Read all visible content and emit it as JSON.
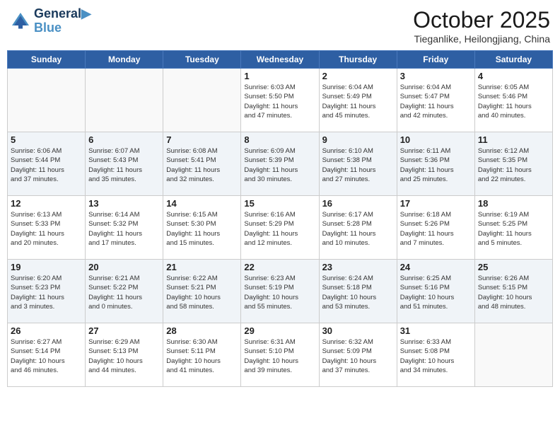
{
  "header": {
    "logo_line1": "General",
    "logo_line2": "Blue",
    "month": "October 2025",
    "location": "Tieganlike, Heilongjiang, China"
  },
  "weekdays": [
    "Sunday",
    "Monday",
    "Tuesday",
    "Wednesday",
    "Thursday",
    "Friday",
    "Saturday"
  ],
  "weeks": [
    [
      {
        "day": "",
        "info": ""
      },
      {
        "day": "",
        "info": ""
      },
      {
        "day": "",
        "info": ""
      },
      {
        "day": "1",
        "info": "Sunrise: 6:03 AM\nSunset: 5:50 PM\nDaylight: 11 hours\nand 47 minutes."
      },
      {
        "day": "2",
        "info": "Sunrise: 6:04 AM\nSunset: 5:49 PM\nDaylight: 11 hours\nand 45 minutes."
      },
      {
        "day": "3",
        "info": "Sunrise: 6:04 AM\nSunset: 5:47 PM\nDaylight: 11 hours\nand 42 minutes."
      },
      {
        "day": "4",
        "info": "Sunrise: 6:05 AM\nSunset: 5:46 PM\nDaylight: 11 hours\nand 40 minutes."
      }
    ],
    [
      {
        "day": "5",
        "info": "Sunrise: 6:06 AM\nSunset: 5:44 PM\nDaylight: 11 hours\nand 37 minutes."
      },
      {
        "day": "6",
        "info": "Sunrise: 6:07 AM\nSunset: 5:43 PM\nDaylight: 11 hours\nand 35 minutes."
      },
      {
        "day": "7",
        "info": "Sunrise: 6:08 AM\nSunset: 5:41 PM\nDaylight: 11 hours\nand 32 minutes."
      },
      {
        "day": "8",
        "info": "Sunrise: 6:09 AM\nSunset: 5:39 PM\nDaylight: 11 hours\nand 30 minutes."
      },
      {
        "day": "9",
        "info": "Sunrise: 6:10 AM\nSunset: 5:38 PM\nDaylight: 11 hours\nand 27 minutes."
      },
      {
        "day": "10",
        "info": "Sunrise: 6:11 AM\nSunset: 5:36 PM\nDaylight: 11 hours\nand 25 minutes."
      },
      {
        "day": "11",
        "info": "Sunrise: 6:12 AM\nSunset: 5:35 PM\nDaylight: 11 hours\nand 22 minutes."
      }
    ],
    [
      {
        "day": "12",
        "info": "Sunrise: 6:13 AM\nSunset: 5:33 PM\nDaylight: 11 hours\nand 20 minutes."
      },
      {
        "day": "13",
        "info": "Sunrise: 6:14 AM\nSunset: 5:32 PM\nDaylight: 11 hours\nand 17 minutes."
      },
      {
        "day": "14",
        "info": "Sunrise: 6:15 AM\nSunset: 5:30 PM\nDaylight: 11 hours\nand 15 minutes."
      },
      {
        "day": "15",
        "info": "Sunrise: 6:16 AM\nSunset: 5:29 PM\nDaylight: 11 hours\nand 12 minutes."
      },
      {
        "day": "16",
        "info": "Sunrise: 6:17 AM\nSunset: 5:28 PM\nDaylight: 11 hours\nand 10 minutes."
      },
      {
        "day": "17",
        "info": "Sunrise: 6:18 AM\nSunset: 5:26 PM\nDaylight: 11 hours\nand 7 minutes."
      },
      {
        "day": "18",
        "info": "Sunrise: 6:19 AM\nSunset: 5:25 PM\nDaylight: 11 hours\nand 5 minutes."
      }
    ],
    [
      {
        "day": "19",
        "info": "Sunrise: 6:20 AM\nSunset: 5:23 PM\nDaylight: 11 hours\nand 3 minutes."
      },
      {
        "day": "20",
        "info": "Sunrise: 6:21 AM\nSunset: 5:22 PM\nDaylight: 11 hours\nand 0 minutes."
      },
      {
        "day": "21",
        "info": "Sunrise: 6:22 AM\nSunset: 5:21 PM\nDaylight: 10 hours\nand 58 minutes."
      },
      {
        "day": "22",
        "info": "Sunrise: 6:23 AM\nSunset: 5:19 PM\nDaylight: 10 hours\nand 55 minutes."
      },
      {
        "day": "23",
        "info": "Sunrise: 6:24 AM\nSunset: 5:18 PM\nDaylight: 10 hours\nand 53 minutes."
      },
      {
        "day": "24",
        "info": "Sunrise: 6:25 AM\nSunset: 5:16 PM\nDaylight: 10 hours\nand 51 minutes."
      },
      {
        "day": "25",
        "info": "Sunrise: 6:26 AM\nSunset: 5:15 PM\nDaylight: 10 hours\nand 48 minutes."
      }
    ],
    [
      {
        "day": "26",
        "info": "Sunrise: 6:27 AM\nSunset: 5:14 PM\nDaylight: 10 hours\nand 46 minutes."
      },
      {
        "day": "27",
        "info": "Sunrise: 6:29 AM\nSunset: 5:13 PM\nDaylight: 10 hours\nand 44 minutes."
      },
      {
        "day": "28",
        "info": "Sunrise: 6:30 AM\nSunset: 5:11 PM\nDaylight: 10 hours\nand 41 minutes."
      },
      {
        "day": "29",
        "info": "Sunrise: 6:31 AM\nSunset: 5:10 PM\nDaylight: 10 hours\nand 39 minutes."
      },
      {
        "day": "30",
        "info": "Sunrise: 6:32 AM\nSunset: 5:09 PM\nDaylight: 10 hours\nand 37 minutes."
      },
      {
        "day": "31",
        "info": "Sunrise: 6:33 AM\nSunset: 5:08 PM\nDaylight: 10 hours\nand 34 minutes."
      },
      {
        "day": "",
        "info": ""
      }
    ]
  ]
}
